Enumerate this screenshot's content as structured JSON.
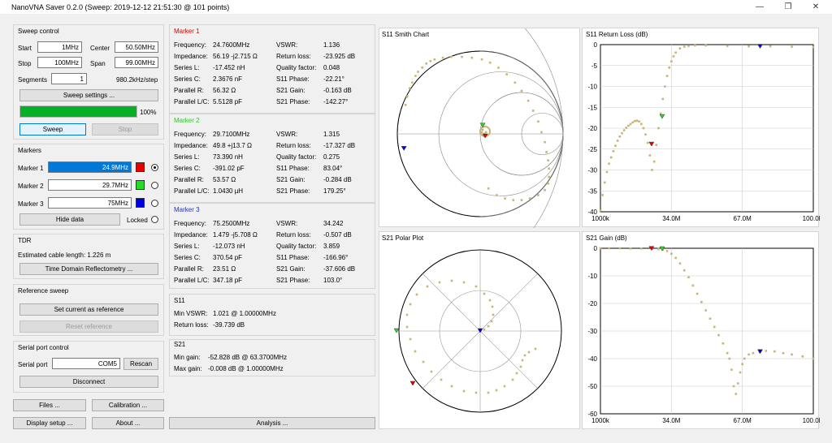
{
  "window": {
    "title": "NanoVNA Saver 0.2.0 (Sweep: 2019-12-12 21:51:30 @ 101 points)",
    "min": "—",
    "max": "❐",
    "close": "✕"
  },
  "sweep": {
    "title": "Sweep control",
    "start_label": "Start",
    "start": "1MHz",
    "center_label": "Center",
    "center": "50.50MHz",
    "stop_label": "Stop",
    "stop": "100MHz",
    "span_label": "Span",
    "span": "99.00MHz",
    "segments_label": "Segments",
    "segments": "1",
    "step": "980.2kHz/step",
    "settings_btn": "Sweep settings ...",
    "progress": 1.0,
    "progress_text": "100%",
    "sweep_btn": "Sweep",
    "stop_btn": "Stop"
  },
  "markers_ctl": {
    "title": "Markers",
    "items": [
      {
        "label": "Marker 1",
        "value": "24.9MHz",
        "color": "#e60000",
        "selected": true
      },
      {
        "label": "Marker 2",
        "value": "29.7MHz",
        "color": "#22dd22",
        "selected": false
      },
      {
        "label": "Marker 3",
        "value": "75MHz",
        "color": "#0000dd",
        "selected": false
      }
    ],
    "hide_btn": "Hide data",
    "locked": "Locked"
  },
  "tdr": {
    "title": "TDR",
    "cable": "Estimated cable length:  1.226 m",
    "btn": "Time Domain Reflectometry ..."
  },
  "ref": {
    "title": "Reference sweep",
    "set_btn": "Set current as reference",
    "reset_btn": "Reset reference"
  },
  "serial": {
    "title": "Serial port control",
    "port_label": "Serial port",
    "port": "COM5",
    "rescan": "Rescan",
    "disconnect": "Disconnect"
  },
  "bottom": {
    "files": "Files ...",
    "calibration": "Calibration ...",
    "display": "Display setup ...",
    "about": "About ...",
    "analysis": "Analysis ..."
  },
  "marker_data": [
    {
      "title": "Marker 1",
      "color": "#e60000",
      "left": [
        [
          "Frequency:",
          "24.7600MHz"
        ],
        [
          "Impedance:",
          "56.19 -j2.715 Ω"
        ],
        [
          "Series L:",
          "-17.452 nH"
        ],
        [
          "Series C:",
          "2.3676 nF"
        ],
        [
          "Parallel R:",
          "56.32 Ω"
        ],
        [
          "Parallel L/C:",
          "5.5128 pF"
        ]
      ],
      "right": [
        [
          "VSWR:",
          "1.136"
        ],
        [
          "Return loss:",
          "-23.925 dB"
        ],
        [
          "Quality factor:",
          "0.048"
        ],
        [
          "S11 Phase:",
          "-22.21°"
        ],
        [
          "S21 Gain:",
          "-0.163 dB"
        ],
        [
          "S21 Phase:",
          "-142.27°"
        ]
      ]
    },
    {
      "title": "Marker 2",
      "color": "#22cc22",
      "left": [
        [
          "Frequency:",
          "29.7100MHz"
        ],
        [
          "Impedance:",
          "49.8 +j13.7 Ω"
        ],
        [
          "Series L:",
          "73.390 nH"
        ],
        [
          "Series C:",
          "-391.02 pF"
        ],
        [
          "Parallel R:",
          "53.57 Ω"
        ],
        [
          "Parallel L/C:",
          "1.0430 µH"
        ]
      ],
      "right": [
        [
          "VSWR:",
          "1.315"
        ],
        [
          "Return loss:",
          "-17.327 dB"
        ],
        [
          "Quality factor:",
          "0.275"
        ],
        [
          "S11 Phase:",
          "83.04°"
        ],
        [
          "S21 Gain:",
          "-0.284 dB"
        ],
        [
          "S21 Phase:",
          "179.25°"
        ]
      ]
    },
    {
      "title": "Marker 3",
      "color": "#2233cc",
      "left": [
        [
          "Frequency:",
          "75.2500MHz"
        ],
        [
          "Impedance:",
          "1.479 -j5.708 Ω"
        ],
        [
          "Series L:",
          "-12.073 nH"
        ],
        [
          "Series C:",
          "370.54 pF"
        ],
        [
          "Parallel R:",
          "23.51 Ω"
        ],
        [
          "Parallel L/C:",
          "347.18 pF"
        ]
      ],
      "right": [
        [
          "VSWR:",
          "34.242"
        ],
        [
          "Return loss:",
          "-0.507 dB"
        ],
        [
          "Quality factor:",
          "3.859"
        ],
        [
          "S11 Phase:",
          "-166.96°"
        ],
        [
          "S21 Gain:",
          "-37.606 dB"
        ],
        [
          "S21 Phase:",
          "103.0°"
        ]
      ]
    }
  ],
  "s11": {
    "title": "S11",
    "vswr_label": "Min VSWR:",
    "vswr": "1.021 @ 1.00000MHz",
    "rl_label": "Return loss:",
    "rl": "-39.739 dB"
  },
  "s21": {
    "title": "S21",
    "min_label": "Min gain:",
    "min": "-52.828 dB @ 63.3700MHz",
    "max_label": "Max gain:",
    "max": "-0.008 dB @ 1.00000MHz"
  },
  "chart_titles": {
    "smith": "S11 Smith Chart",
    "rl": "S11 Return Loss (dB)",
    "polar": "S21 Polar Plot",
    "gain": "S21 Gain (dB)"
  },
  "chart_data": [
    {
      "type": "line",
      "title": "S11 Return Loss (dB)",
      "x_ticks": [
        "1000k",
        "34.0M",
        "67.0M",
        "100.0M"
      ],
      "y_ticks": [
        "0",
        "-5",
        "-10",
        "-15",
        "-20",
        "-25",
        "-30",
        "-35",
        "-40"
      ],
      "ylim": [
        -40,
        0
      ],
      "xlim": [
        1,
        100
      ],
      "x": [
        1,
        2,
        3,
        4,
        5,
        6,
        7,
        8,
        9,
        10,
        11,
        12,
        13,
        14,
        15,
        16,
        17,
        18,
        19,
        20,
        21,
        22,
        23,
        24,
        25,
        26,
        27,
        28,
        29,
        30,
        31,
        32,
        33,
        34,
        35,
        36,
        38,
        40,
        42,
        45,
        50,
        60,
        70,
        80,
        90,
        100
      ],
      "values": [
        -39.7,
        -36,
        -33,
        -30.5,
        -28.5,
        -27,
        -25.5,
        -24.2,
        -23,
        -22,
        -21.2,
        -20.5,
        -19.9,
        -19.4,
        -19,
        -18.6,
        -18.3,
        -18.2,
        -18.4,
        -19,
        -20,
        -21.5,
        -23.5,
        -26.5,
        -30,
        -28,
        -24,
        -20,
        -16.5,
        -13,
        -10,
        -7.5,
        -5.5,
        -4,
        -2.8,
        -1.9,
        -0.9,
        -0.5,
        -0.3,
        -0.2,
        -0.2,
        -0.3,
        -0.4,
        -0.4,
        -0.5,
        -0.6
      ]
    },
    {
      "type": "line",
      "title": "S21 Gain (dB)",
      "x_ticks": [
        "1000k",
        "34.0M",
        "67.0M",
        "100.0M"
      ],
      "y_ticks": [
        "0",
        "-10",
        "-20",
        "-30",
        "-40",
        "-50",
        "-60"
      ],
      "ylim": [
        -60,
        0
      ],
      "xlim": [
        1,
        100
      ],
      "x": [
        1,
        5,
        10,
        15,
        20,
        25,
        28,
        30,
        32,
        34,
        36,
        38,
        40,
        42,
        44,
        46,
        48,
        50,
        52,
        54,
        56,
        58,
        60,
        61,
        62,
        63,
        64,
        65,
        66,
        67,
        68,
        70,
        72,
        75,
        78,
        82,
        86,
        90,
        95,
        100
      ],
      "values": [
        0,
        0,
        0,
        -0.1,
        -0.1,
        -0.2,
        -0.3,
        -0.5,
        -1,
        -2,
        -3.5,
        -5.5,
        -8,
        -10.5,
        -13.5,
        -16.5,
        -19.5,
        -22.5,
        -25.5,
        -28.5,
        -31.5,
        -34.5,
        -38,
        -40,
        -44,
        -50,
        -52.8,
        -49,
        -45,
        -42,
        -40,
        -38.5,
        -38,
        -37.6,
        -37.2,
        -37.4,
        -38,
        -38.5,
        -39.2,
        -40
      ]
    },
    {
      "type": "scatter",
      "title": "S11 Smith Chart",
      "x": [
        -0.9,
        -0.88,
        -0.85,
        -0.82,
        -0.78,
        -0.75,
        -0.7,
        -0.65,
        -0.6,
        -0.55,
        -0.45,
        -0.35,
        -0.22,
        -0.1,
        0.02,
        0.12,
        0.22,
        0.32,
        0.42,
        0.5,
        0.58,
        0.64,
        0.7,
        0.74,
        0.78,
        0.8,
        0.82,
        0.83,
        0.83,
        0.82,
        0.78,
        0.7,
        0.6,
        0.5,
        0.4,
        0.3,
        0.2,
        0.1,
        0.02,
        0.03,
        0.05,
        0.06,
        0.07
      ],
      "y": [
        0.35,
        0.45,
        0.55,
        0.62,
        0.7,
        0.75,
        0.8,
        0.85,
        0.88,
        0.9,
        0.92,
        0.93,
        0.93,
        0.92,
        0.9,
        0.86,
        0.8,
        0.72,
        0.62,
        0.52,
        0.4,
        0.28,
        0.15,
        0.02,
        -0.1,
        -0.22,
        -0.32,
        -0.42,
        -0.52,
        -0.6,
        -0.68,
        -0.74,
        -0.78,
        -0.8,
        -0.8,
        -0.78,
        -0.74,
        -0.66,
        0.02,
        0.05,
        0.0,
        -0.02,
        0.02
      ]
    },
    {
      "type": "scatter",
      "title": "S21 Polar Plot",
      "x": [
        0,
        0.05,
        0.1,
        0.14,
        0.16,
        0.15,
        0.12,
        0.05,
        -0.05,
        -0.2,
        -0.35,
        -0.5,
        -0.65,
        -0.78,
        -0.86,
        -0.9,
        -0.9,
        -0.86,
        -0.8,
        -0.7,
        -0.6,
        -0.48,
        -0.35,
        -0.2,
        -0.05,
        0.1,
        0.2,
        0.3,
        0.4,
        0.45,
        0.5,
        0.52,
        0.55,
        0.6,
        0.68
      ],
      "y": [
        0,
        0.02,
        0.06,
        0.12,
        0.2,
        0.3,
        0.38,
        0.46,
        0.55,
        0.6,
        0.62,
        0.6,
        0.55,
        0.45,
        0.33,
        0.2,
        0.05,
        -0.1,
        -0.25,
        -0.38,
        -0.5,
        -0.6,
        -0.68,
        -0.74,
        -0.76,
        -0.76,
        -0.73,
        -0.68,
        -0.6,
        -0.52,
        -0.44,
        -0.36,
        -0.3,
        -0.26,
        -0.22
      ]
    }
  ]
}
